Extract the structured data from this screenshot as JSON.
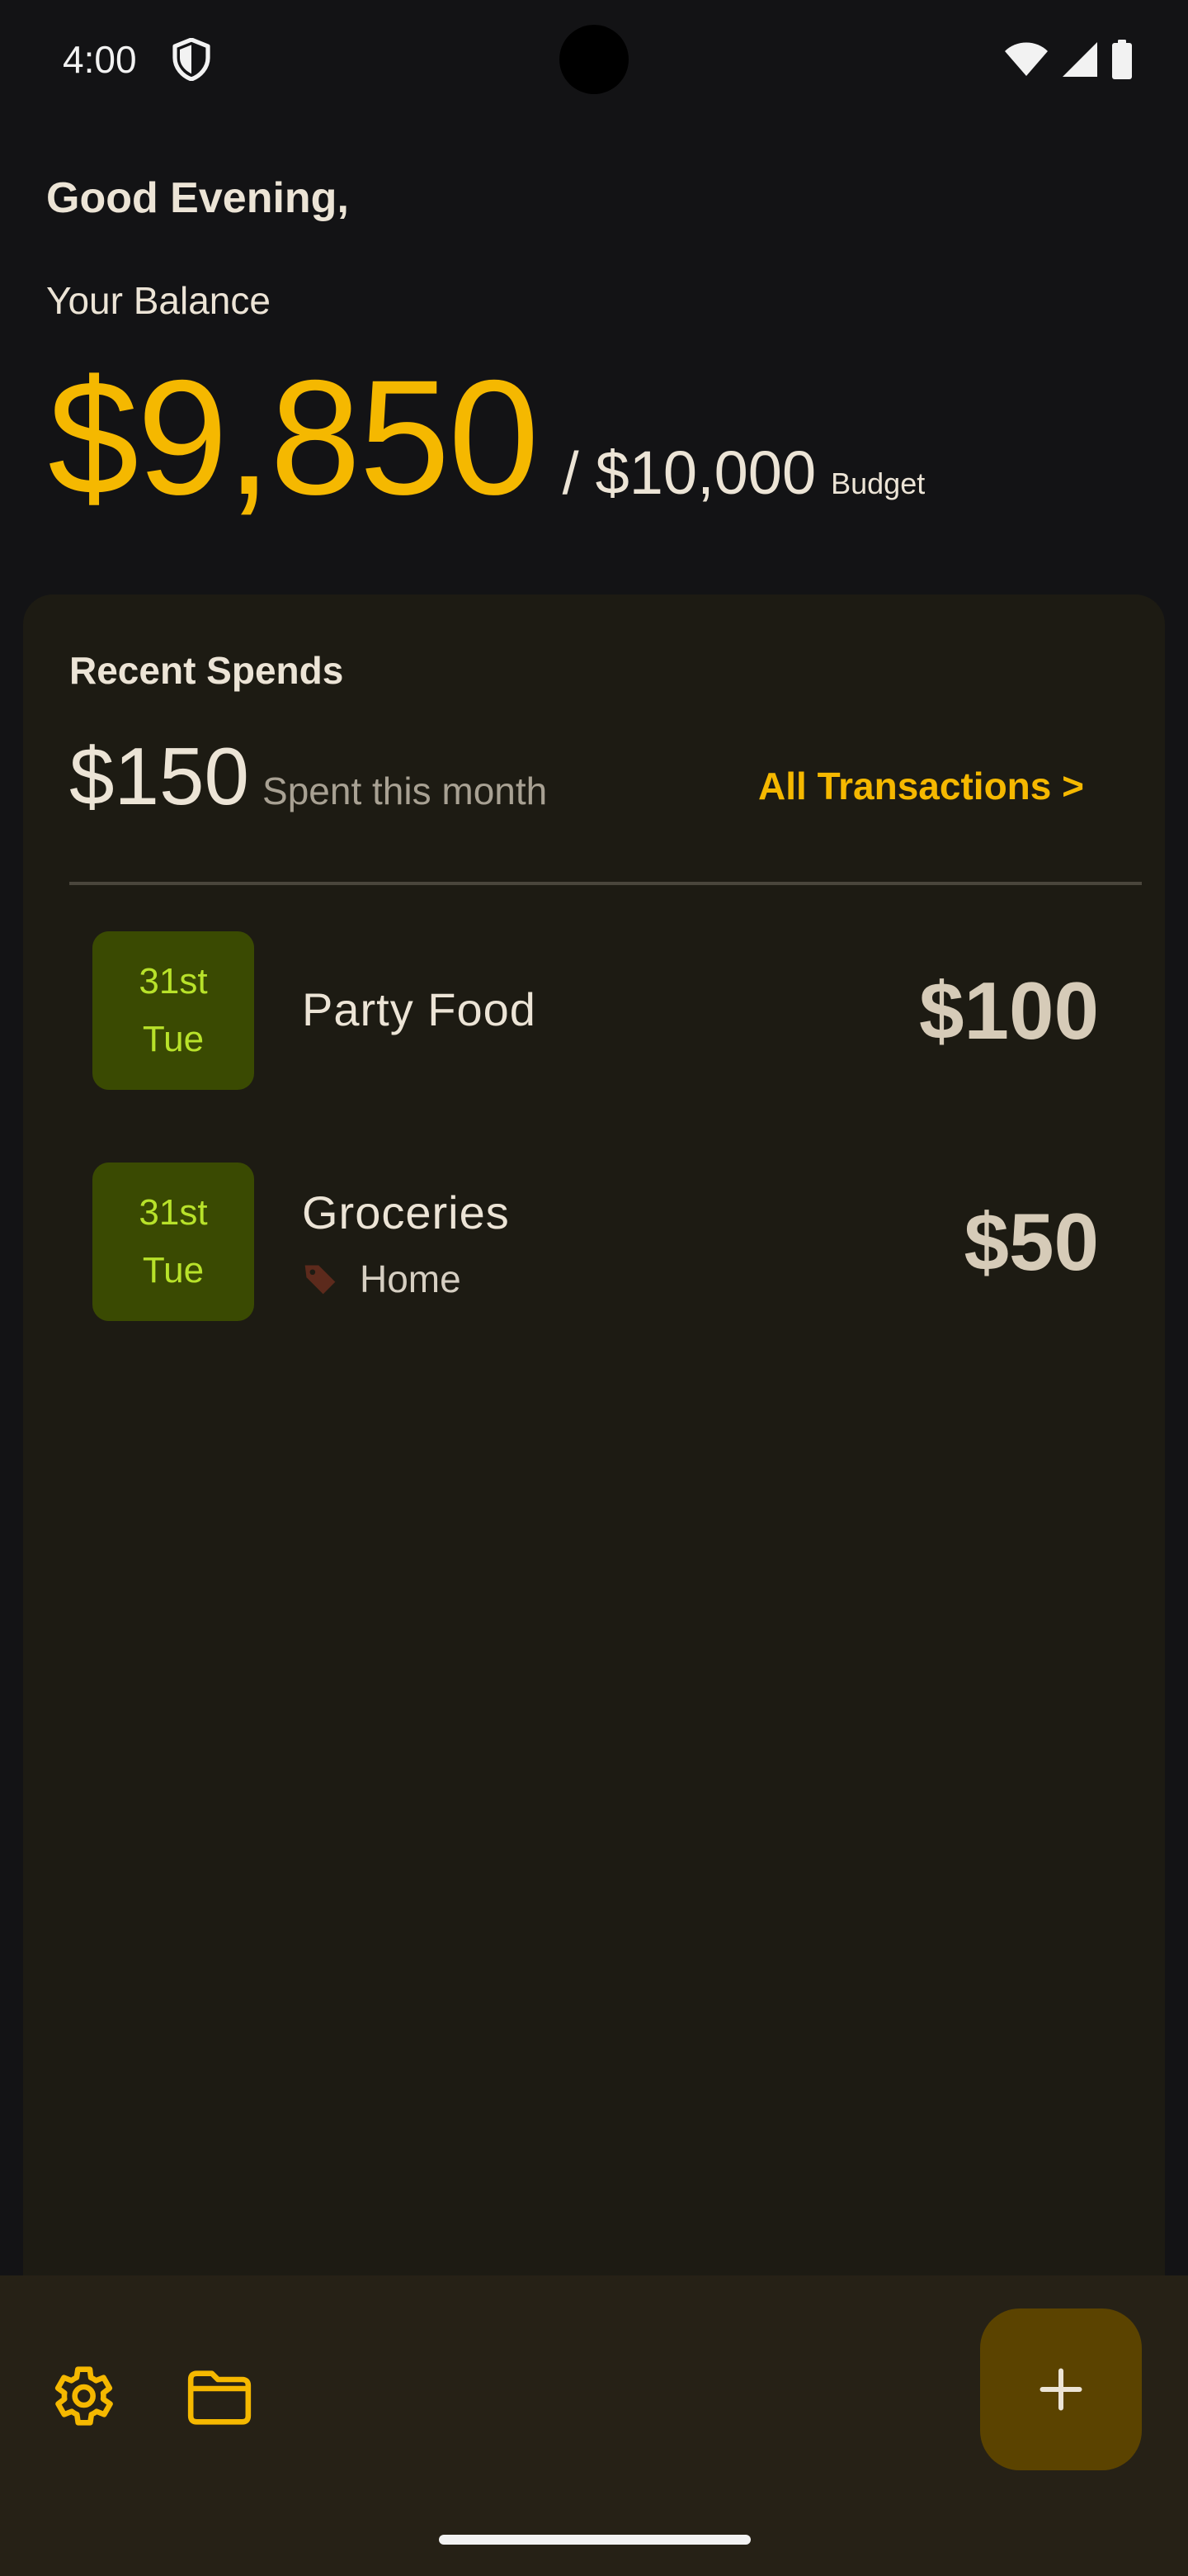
{
  "status_bar": {
    "time": "4:00",
    "icons": [
      "shield-icon",
      "wifi-icon",
      "signal-icon",
      "battery-icon"
    ]
  },
  "header": {
    "greeting": "Good Evening,",
    "balance_label": "Your Balance",
    "balance": "$9,850",
    "separator": "/",
    "budget": "$10,000",
    "budget_label": "Budget"
  },
  "recent_spends": {
    "title": "Recent Spends",
    "spent_amount": "$150",
    "spent_label": "Spent this month",
    "all_transactions_label": "All Transactions >",
    "transactions": [
      {
        "day": "31st",
        "weekday": "Tue",
        "name": "Party Food",
        "category": "",
        "amount": "$100"
      },
      {
        "day": "31st",
        "weekday": "Tue",
        "name": "Groceries",
        "category": "Home",
        "category_icon": "tag-icon",
        "amount": "$50"
      }
    ]
  },
  "bottom_bar": {
    "icons": [
      "gear-icon",
      "folder-icon",
      "plus-icon"
    ]
  },
  "colors": {
    "accent": "#f5b800",
    "date_badge_bg": "#3a4a02",
    "date_badge_text": "#b8e22a",
    "card_bg": "#1d1b13",
    "bottom_bar_bg": "#262116",
    "fab_bg": "#5b4300"
  }
}
